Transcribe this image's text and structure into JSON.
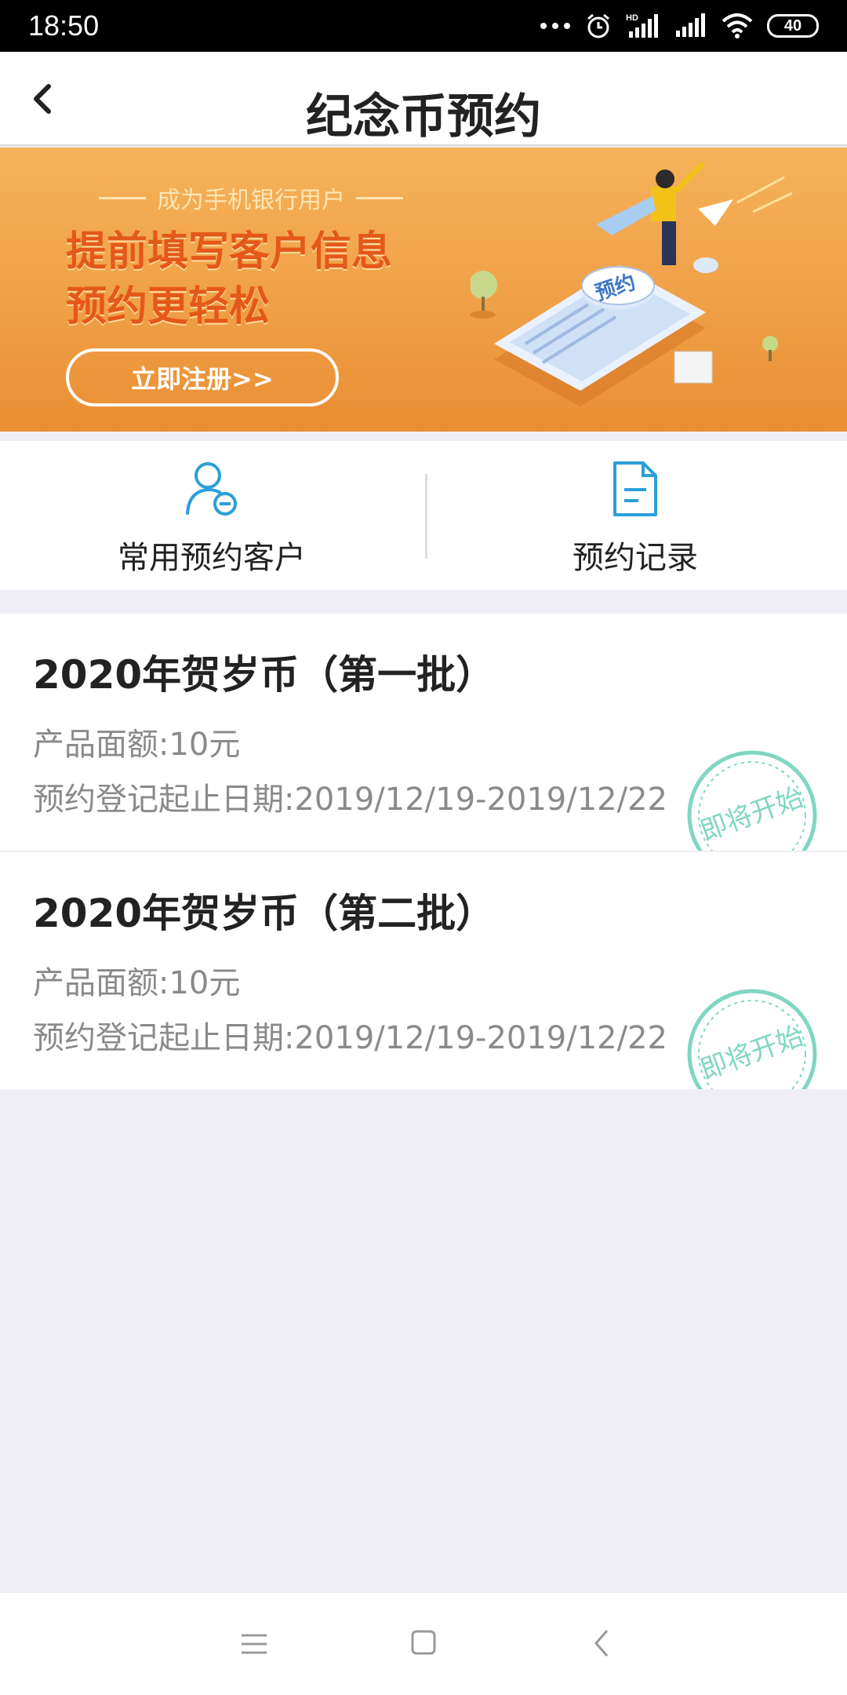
{
  "status_bar": {
    "time": "18:50",
    "battery": "40",
    "icons": [
      "more-dots-icon",
      "alarm-icon",
      "hd-signal-icon",
      "signal-icon",
      "wifi-icon",
      "battery-icon"
    ]
  },
  "header": {
    "title": "纪念币预约",
    "back_icon": "chevron-left-icon"
  },
  "banner": {
    "subtitle": "成为手机银行用户",
    "headline_line1": "提前填写客户信息",
    "headline_line2": "预约更轻松",
    "register_button": "立即注册>>",
    "illustration_badge": "预约",
    "colors": {
      "background": "#f0a047",
      "headline": "#e4581a"
    }
  },
  "shortcuts": [
    {
      "label": "常用预约客户",
      "icon": "user-minus-icon"
    },
    {
      "label": "预约记录",
      "icon": "document-icon"
    }
  ],
  "products": [
    {
      "title": "2020年贺岁币（第一批）",
      "face_value": "产品面额:10元",
      "period": "预约登记起止日期:2019/12/19-2019/12/22",
      "stamp": "即将开始"
    },
    {
      "title": "2020年贺岁币（第二批）",
      "face_value": "产品面额:10元",
      "period": "预约登记起止日期:2019/12/19-2019/12/22",
      "stamp": "即将开始"
    }
  ],
  "bottom_nav": {
    "icons": [
      "menu-icon",
      "home-square-icon",
      "back-triangle-icon"
    ]
  },
  "colors": {
    "accent": "#2a9fd8",
    "stamp": "#7fd6c2",
    "page_bg": "#efeef6"
  }
}
